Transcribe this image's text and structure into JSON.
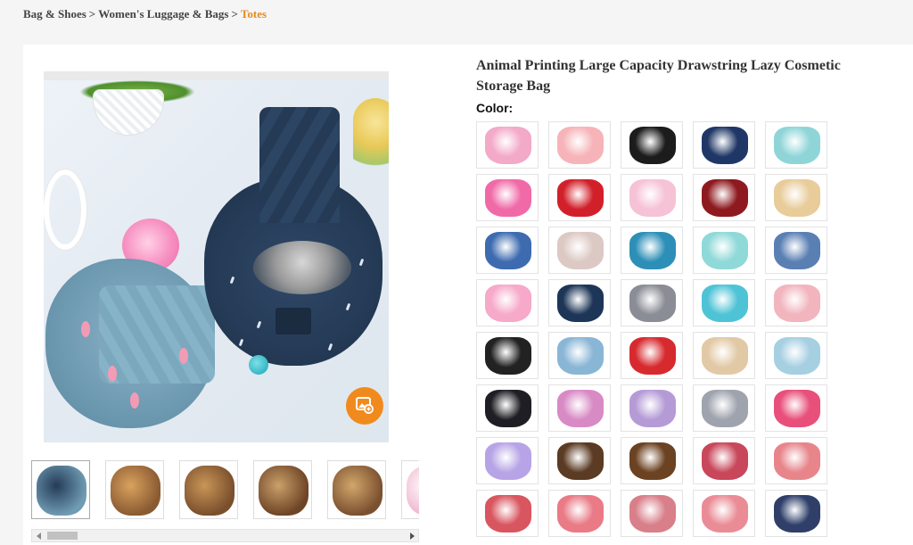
{
  "breadcrumb": {
    "items": [
      "Bag & Shoes",
      "Women's Luggage & Bags"
    ],
    "separator": ">",
    "current": "Totes"
  },
  "product": {
    "title": "Animal Printing Large Capacity Drawstring Lazy Cosmetic Storage Bag",
    "color_label": "Color:"
  },
  "colors": {
    "accent": "#f18a1d",
    "breadcrumb_current": "#e8891d"
  },
  "icons": {
    "zoom": "image-zoom-icon",
    "scroll_left": "chevron-left-icon",
    "scroll_right": "chevron-right-icon"
  },
  "thumbnails": [
    {
      "name": "thumb-1",
      "palette": [
        "#6f9bb3",
        "#253b57"
      ]
    },
    {
      "name": "thumb-2",
      "palette": [
        "#8a5a32",
        "#d9a25e"
      ]
    },
    {
      "name": "thumb-3",
      "palette": [
        "#7a4f2c",
        "#c99658"
      ]
    },
    {
      "name": "thumb-4",
      "palette": [
        "#6e4426",
        "#caa06a"
      ]
    },
    {
      "name": "thumb-5",
      "palette": [
        "#7b5030",
        "#d2a76b"
      ]
    },
    {
      "name": "thumb-6",
      "palette": [
        "#f0b7cf",
        "#ffffff"
      ]
    }
  ],
  "swatches": [
    [
      "#f3a9c8",
      "#f6b4b8",
      "#1c1c1c",
      "#1f3766",
      "#8fd5d8"
    ],
    [
      "#f06aa8",
      "#d2202a",
      "#f6c2d6",
      "#8e1a1f",
      "#e8cc9a"
    ],
    [
      "#3e6bb0",
      "#dcc9c4",
      "#2d8fb7",
      "#8fd9d8",
      "#5a7fb3"
    ],
    [
      "#f6a9c9",
      "#1d3557",
      "#8a8d95",
      "#4fc3d6",
      "#f2b4bd"
    ],
    [
      "#222222",
      "#8ab6d6",
      "#d72a2f",
      "#e2c9a6",
      "#a6cfe2"
    ],
    [
      "#1e1e24",
      "#d88ac5",
      "#b59bd6",
      "#9ea3ad",
      "#e84f7a"
    ],
    [
      "#b7a4e6",
      "#5b3b23",
      "#6b4222",
      "#c9475a",
      "#e7858b"
    ],
    [
      "#d9555f",
      "#e97a86",
      "#d97f8a",
      "#ea8c96",
      "#2f3f6a"
    ]
  ]
}
